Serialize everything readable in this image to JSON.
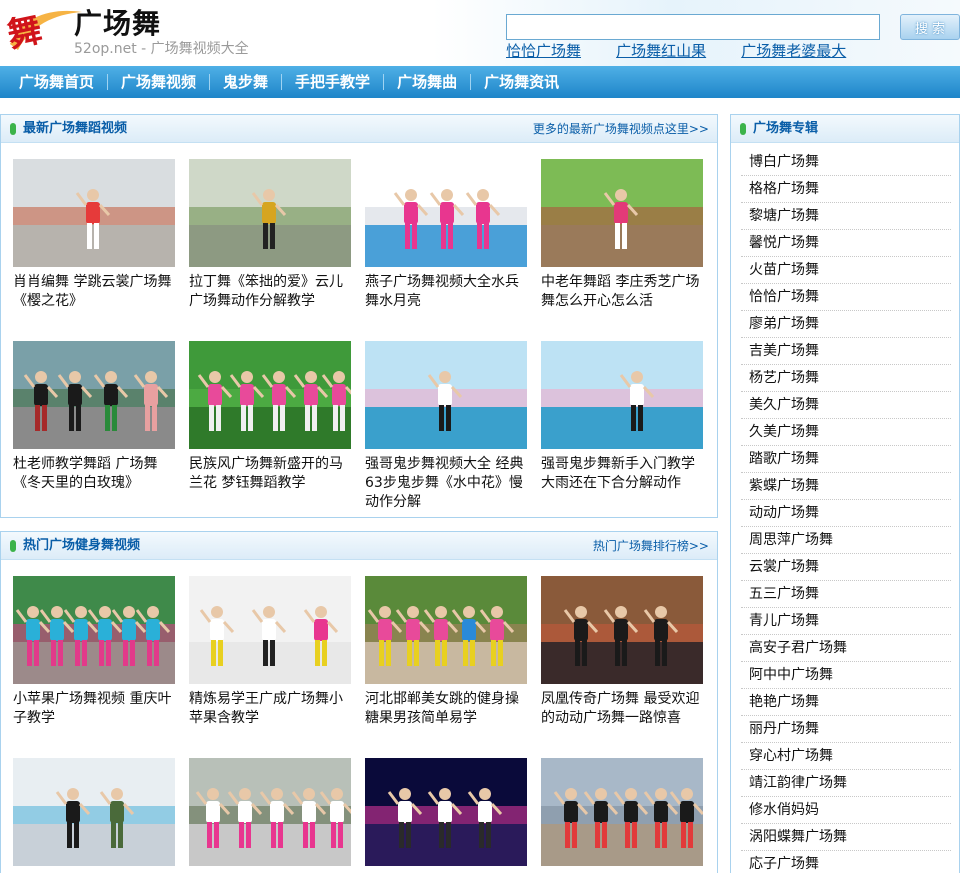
{
  "site": {
    "logo_glyph": "舞",
    "name": "广场舞",
    "subtitle": "52op.net - 广场舞视频大全"
  },
  "search": {
    "value": "",
    "button_label": "搜 索"
  },
  "hot_links": [
    "恰恰广场舞",
    "广场舞红山果",
    "广场舞老婆最大"
  ],
  "nav": [
    "广场舞首页",
    "广场舞视频",
    "鬼步舞",
    "手把手教学",
    "广场舞曲",
    "广场舞资讯"
  ],
  "latest": {
    "title": "最新广场舞蹈视频",
    "more": "更多的最新广场舞视频点这里>>",
    "items": [
      {
        "title": "肖肖编舞 学跳云裳广场舞《樱之花》",
        "thumb": "plaza"
      },
      {
        "title": "拉丁舞《笨拙的爱》云儿广场舞动作分解教学",
        "thumb": "road"
      },
      {
        "title": "燕子广场舞视频大全水兵舞水月亮",
        "thumb": "trio"
      },
      {
        "title": "中老年舞蹈 李庄秀芝广场舞怎么开心怎么活",
        "thumb": "yard"
      },
      {
        "title": "杜老师教学舞蹈 广场舞《冬天里的白玫瑰》",
        "thumb": "group"
      },
      {
        "title": "民族风广场舞新盛开的马兰花 梦钰舞蹈教学",
        "thumb": "grass"
      },
      {
        "title": "强哥鬼步舞视频大全 经典63步鬼步舞《水中花》慢动作分解",
        "thumb": "lotus"
      },
      {
        "title": "强哥鬼步舞新手入门教学大雨还在下合分解动作",
        "thumb": "lotus2"
      }
    ]
  },
  "hot": {
    "title": "热门广场健身舞视频",
    "more": "热门广场舞排行榜>>",
    "items": [
      {
        "title": "小苹果广场舞视频 重庆叶子教学",
        "thumb": "park"
      },
      {
        "title": "精炼易学王广成广场舞小苹果含教学",
        "thumb": "studio"
      },
      {
        "title": "河北邯郸美女跳的健身操糖果男孩简单易学",
        "thumb": "square"
      },
      {
        "title": "凤凰传奇广场舞 最受欢迎的动动广场舞一路惊喜",
        "thumb": "stage"
      },
      {
        "title": "",
        "thumb": "room"
      },
      {
        "title": "",
        "thumb": "tree"
      },
      {
        "title": "",
        "thumb": "concert"
      },
      {
        "title": "",
        "thumb": "city"
      }
    ]
  },
  "album": {
    "title": "广场舞专辑",
    "items": [
      "博白广场舞",
      "格格广场舞",
      "黎塘广场舞",
      "馨悦广场舞",
      "火苗广场舞",
      "恰恰广场舞",
      "廖弟广场舞",
      "吉美广场舞",
      "杨艺广场舞",
      "美久广场舞",
      "久美广场舞",
      "踏歌广场舞",
      "紫蝶广场舞",
      "动动广场舞",
      "周思萍广场舞",
      "云裳广场舞",
      "五三广场舞",
      "青儿广场舞",
      "高安子君广场舞",
      "阿中中广场舞",
      "艳艳广场舞",
      "丽丹广场舞",
      "穿心村广场舞",
      "靖江韵律广场舞",
      "修水俏妈妈",
      "涡阳蝶舞广场舞",
      "応子广场舞"
    ]
  }
}
